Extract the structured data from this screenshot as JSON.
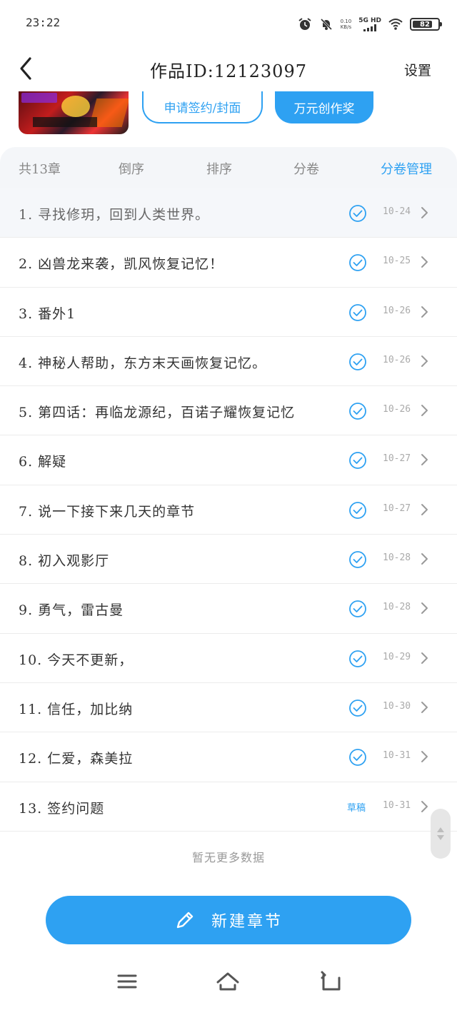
{
  "status_bar": {
    "time": "23:22",
    "speed_value": "0.10",
    "speed_unit": "KB/s",
    "network": "5G HD",
    "battery": "82",
    "icons": [
      "alarm-icon",
      "mute-bell-icon",
      "signal-icon",
      "wifi-icon",
      "battery-icon"
    ]
  },
  "header": {
    "title": "作品ID:12123097",
    "settings_label": "设置",
    "back_icon": "chevron-left-icon"
  },
  "cover": {
    "sign_button_label": "申请签约/封面",
    "award_button_label": "万元创作奖"
  },
  "tabs": [
    {
      "label": "共13章",
      "active": false
    },
    {
      "label": "倒序",
      "active": false
    },
    {
      "label": "排序",
      "active": false
    },
    {
      "label": "分卷",
      "active": false
    },
    {
      "label": "分卷管理",
      "active": true
    }
  ],
  "chapters": [
    {
      "title": "1. 寻找修玥，回到人类世界。",
      "status": "published",
      "date": "10-24"
    },
    {
      "title": "2. 凶兽龙来袭，凯风恢复记忆！",
      "status": "published",
      "date": "10-25"
    },
    {
      "title": "3. 番外1",
      "status": "published",
      "date": "10-26"
    },
    {
      "title": "4. 神秘人帮助，东方末天画恢复记忆。",
      "status": "published",
      "date": "10-26"
    },
    {
      "title": "5. 第四话：再临龙源纪，百诺子耀恢复记忆",
      "status": "published",
      "date": "10-26"
    },
    {
      "title": "6. 解疑",
      "status": "published",
      "date": "10-27"
    },
    {
      "title": "7. 说一下接下来几天的章节",
      "status": "published",
      "date": "10-27"
    },
    {
      "title": "8. 初入观影厅",
      "status": "published",
      "date": "10-28"
    },
    {
      "title": "9. 勇气，雷古曼",
      "status": "published",
      "date": "10-28"
    },
    {
      "title": "10. 今天不更新，",
      "status": "published",
      "date": "10-29"
    },
    {
      "title": "11. 信任，加比纳",
      "status": "published",
      "date": "10-30"
    },
    {
      "title": "12. 仁爱，森美拉",
      "status": "published",
      "date": "10-31"
    },
    {
      "title": "13. 签约问题",
      "status": "draft",
      "draft_label": "草稿",
      "date": "10-31"
    }
  ],
  "list_footer": "暂无更多数据",
  "new_chapter_button": "新建章节",
  "nav_bar": {
    "icons": [
      "menu-icon",
      "home-icon",
      "back-icon"
    ]
  },
  "colors": {
    "accent": "#2ea1f2",
    "text": "#333333",
    "muted": "#aaaaaa",
    "tab_background": "#f4f6f9"
  }
}
